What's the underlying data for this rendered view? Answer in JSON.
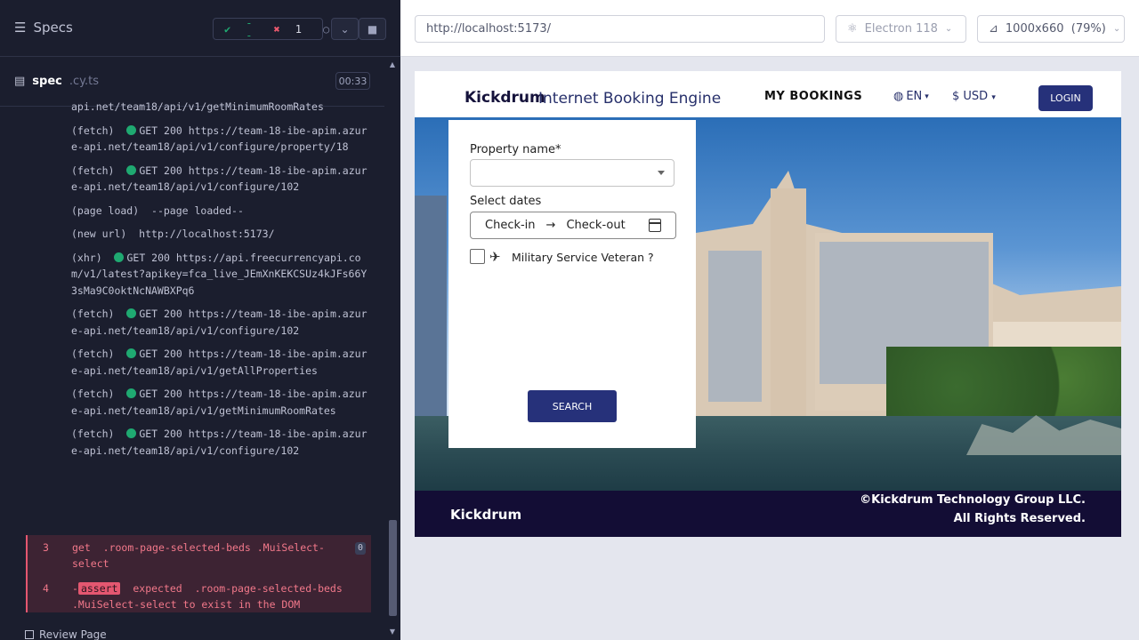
{
  "runner": {
    "specs_label": "Specs",
    "stats": {
      "passed": "--",
      "failed": "1",
      "pending": "--"
    },
    "spec_file": {
      "name": "spec",
      "ext": ".cy.ts"
    },
    "timer": "00:33",
    "log_entries": [
      {
        "tag": "",
        "text": "api.net/team18/api/v1/getMinimumRoomRates",
        "status_dot": false
      },
      {
        "tag": "(fetch)",
        "text": "GET 200 https://team-18-ibe-apim.azure-api.net/team18/api/v1/configure/property/18",
        "status_dot": true
      },
      {
        "tag": "(fetch)",
        "text": "GET 200 https://team-18-ibe-apim.azure-api.net/team18/api/v1/configure/102",
        "status_dot": true
      },
      {
        "tag": "(page load)",
        "text": "--page loaded--",
        "status_dot": false
      },
      {
        "tag": "(new url)",
        "text": "http://localhost:5173/",
        "status_dot": false
      },
      {
        "tag": "(xhr)",
        "text": "GET 200 https://api.freecurrencyapi.com/v1/latest?apikey=fca_live_JEmXnKEKCSUz4kJFs66Y3sMa9C0oktNcNAWBXPq6",
        "status_dot": true
      },
      {
        "tag": "(fetch)",
        "text": "GET 200 https://team-18-ibe-apim.azure-api.net/team18/api/v1/configure/102",
        "status_dot": true
      },
      {
        "tag": "(fetch)",
        "text": "GET 200 https://team-18-ibe-apim.azure-api.net/team18/api/v1/getAllProperties",
        "status_dot": true
      },
      {
        "tag": "(fetch)",
        "text": "GET 200 https://team-18-ibe-apim.azure-api.net/team18/api/v1/getMinimumRoomRates",
        "status_dot": true
      },
      {
        "tag": "(fetch)",
        "text": "GET 200 https://team-18-ibe-apim.azure-api.net/team18/api/v1/configure/102",
        "status_dot": true
      }
    ],
    "command3": {
      "num": "3",
      "cmd": "get",
      "selector": ".room-page-selected-beds .MuiSelect-select",
      "badge": "0"
    },
    "command4": {
      "num": "4",
      "chip": "assert",
      "text_before": "expected",
      "selector": ".room-page-selected-beds .MuiSelect-select",
      "text_after": "to exist in the DOM"
    },
    "review_label": "Review Page"
  },
  "browser": {
    "url": "http://localhost:5173/",
    "browser_name": "Electron 118",
    "viewport": "1000x660",
    "zoom": "(79%)"
  },
  "app": {
    "brand": "Kickdrum",
    "brand_sub": "Internet Booking Engine",
    "my_bookings": "MY BOOKINGS",
    "language": "EN",
    "currency": "$ USD",
    "login": "LOGIN",
    "form": {
      "property_label": "Property name*",
      "dates_label": "Select dates",
      "checkin": "Check-in",
      "arrow": "→",
      "checkout": "Check-out",
      "veteran_label": "Military Service Veteran ?",
      "search": "SEARCH"
    },
    "footer": {
      "brand": "Kickdrum",
      "copy_line1": "©Kickdrum Technology Group LLC.",
      "copy_line2": "All Rights Reserved."
    }
  }
}
